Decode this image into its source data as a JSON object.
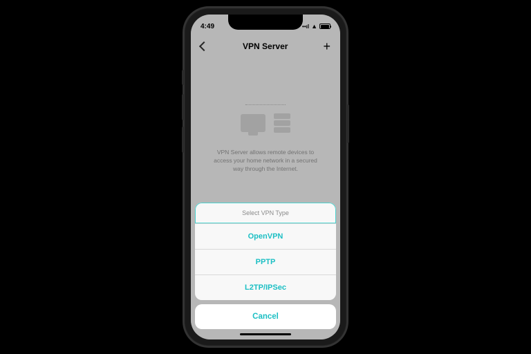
{
  "status_bar": {
    "time": "4:49"
  },
  "nav": {
    "title": "VPN Server"
  },
  "content": {
    "description": "VPN Server allows remote devices to access your home network in a secured way through the Internet."
  },
  "action_sheet": {
    "header": "Select VPN Type",
    "options": [
      "OpenVPN",
      "PPTP",
      "L2TP/IPSec"
    ],
    "cancel": "Cancel"
  }
}
